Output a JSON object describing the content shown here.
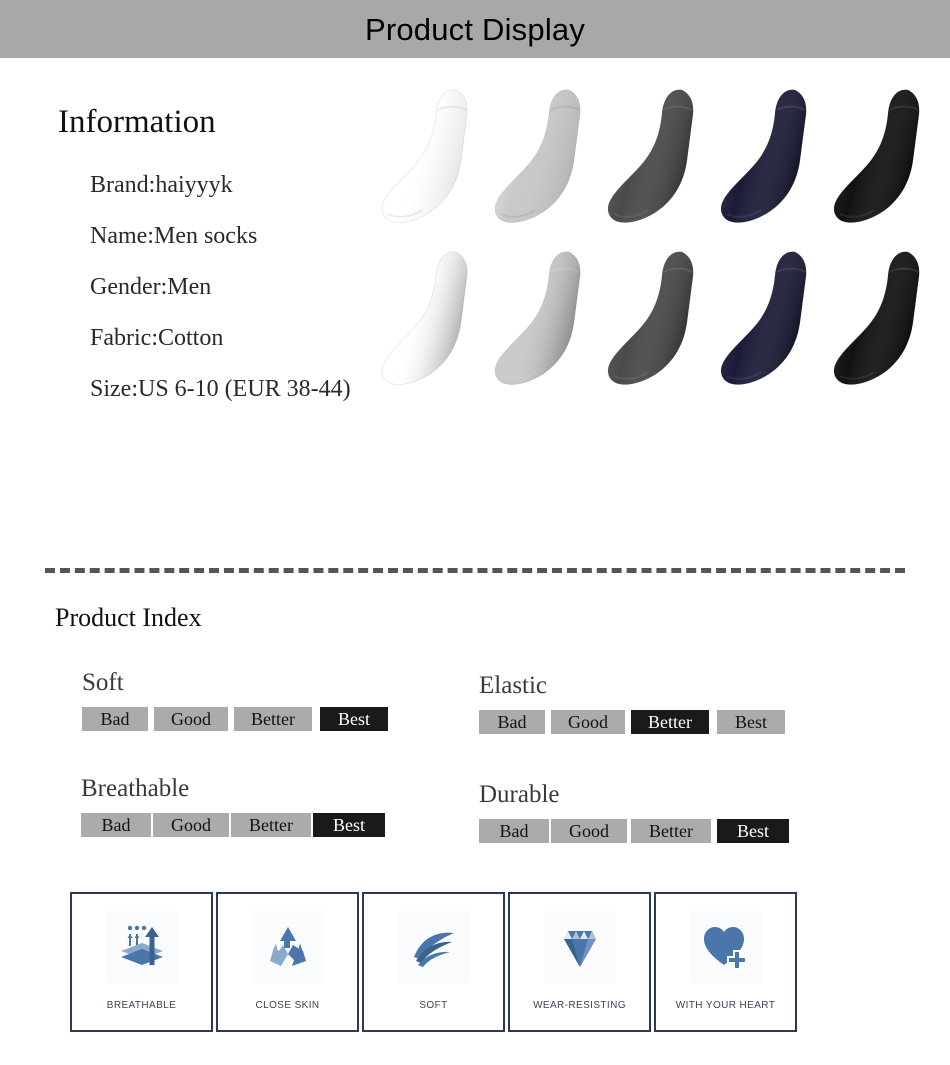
{
  "header": {
    "title": "Product Display"
  },
  "information": {
    "heading": "Information",
    "items": [
      "Brand:haiyyyk",
      "Name:Men socks",
      "Gender:Men",
      "Fabric:Cotton",
      "Size:US 6-10 (EUR 38-44)"
    ]
  },
  "product_photo": {
    "alt": "five pairs of men ankle socks in two rows",
    "rows": 2,
    "colors": [
      "#ffffff",
      "#c9c9c9",
      "#4a4a4a",
      "#1b1b38",
      "#111111"
    ],
    "color_names": [
      "white",
      "light-gray",
      "dark-gray",
      "navy",
      "black"
    ]
  },
  "product_index": {
    "heading": "Product Index",
    "scale": [
      "Bad",
      "Good",
      "Better",
      "Best"
    ],
    "groups": [
      {
        "label": "Soft",
        "selected": "Best"
      },
      {
        "label": "Elastic",
        "selected": "Better"
      },
      {
        "label": "Breathable",
        "selected": "Best"
      },
      {
        "label": "Durable",
        "selected": "Best"
      }
    ]
  },
  "features": [
    {
      "label": "BREATHABLE",
      "icon": "breathable-arrows-icon"
    },
    {
      "label": "CLOSE SKIN",
      "icon": "recycle-icon"
    },
    {
      "label": "SOFT",
      "icon": "feather-swoosh-icon"
    },
    {
      "label": "WEAR-RESISTING",
      "icon": "diamond-icon"
    },
    {
      "label": "WITH YOUR HEART",
      "icon": "heart-plus-icon"
    }
  ],
  "colors": {
    "header_bg": "#a8a8a8",
    "badge_bg": "#ababab",
    "badge_selected_bg": "#1a1a1a",
    "feature_border": "#2e3a52",
    "feature_icon_blue": "#4a76ab"
  }
}
